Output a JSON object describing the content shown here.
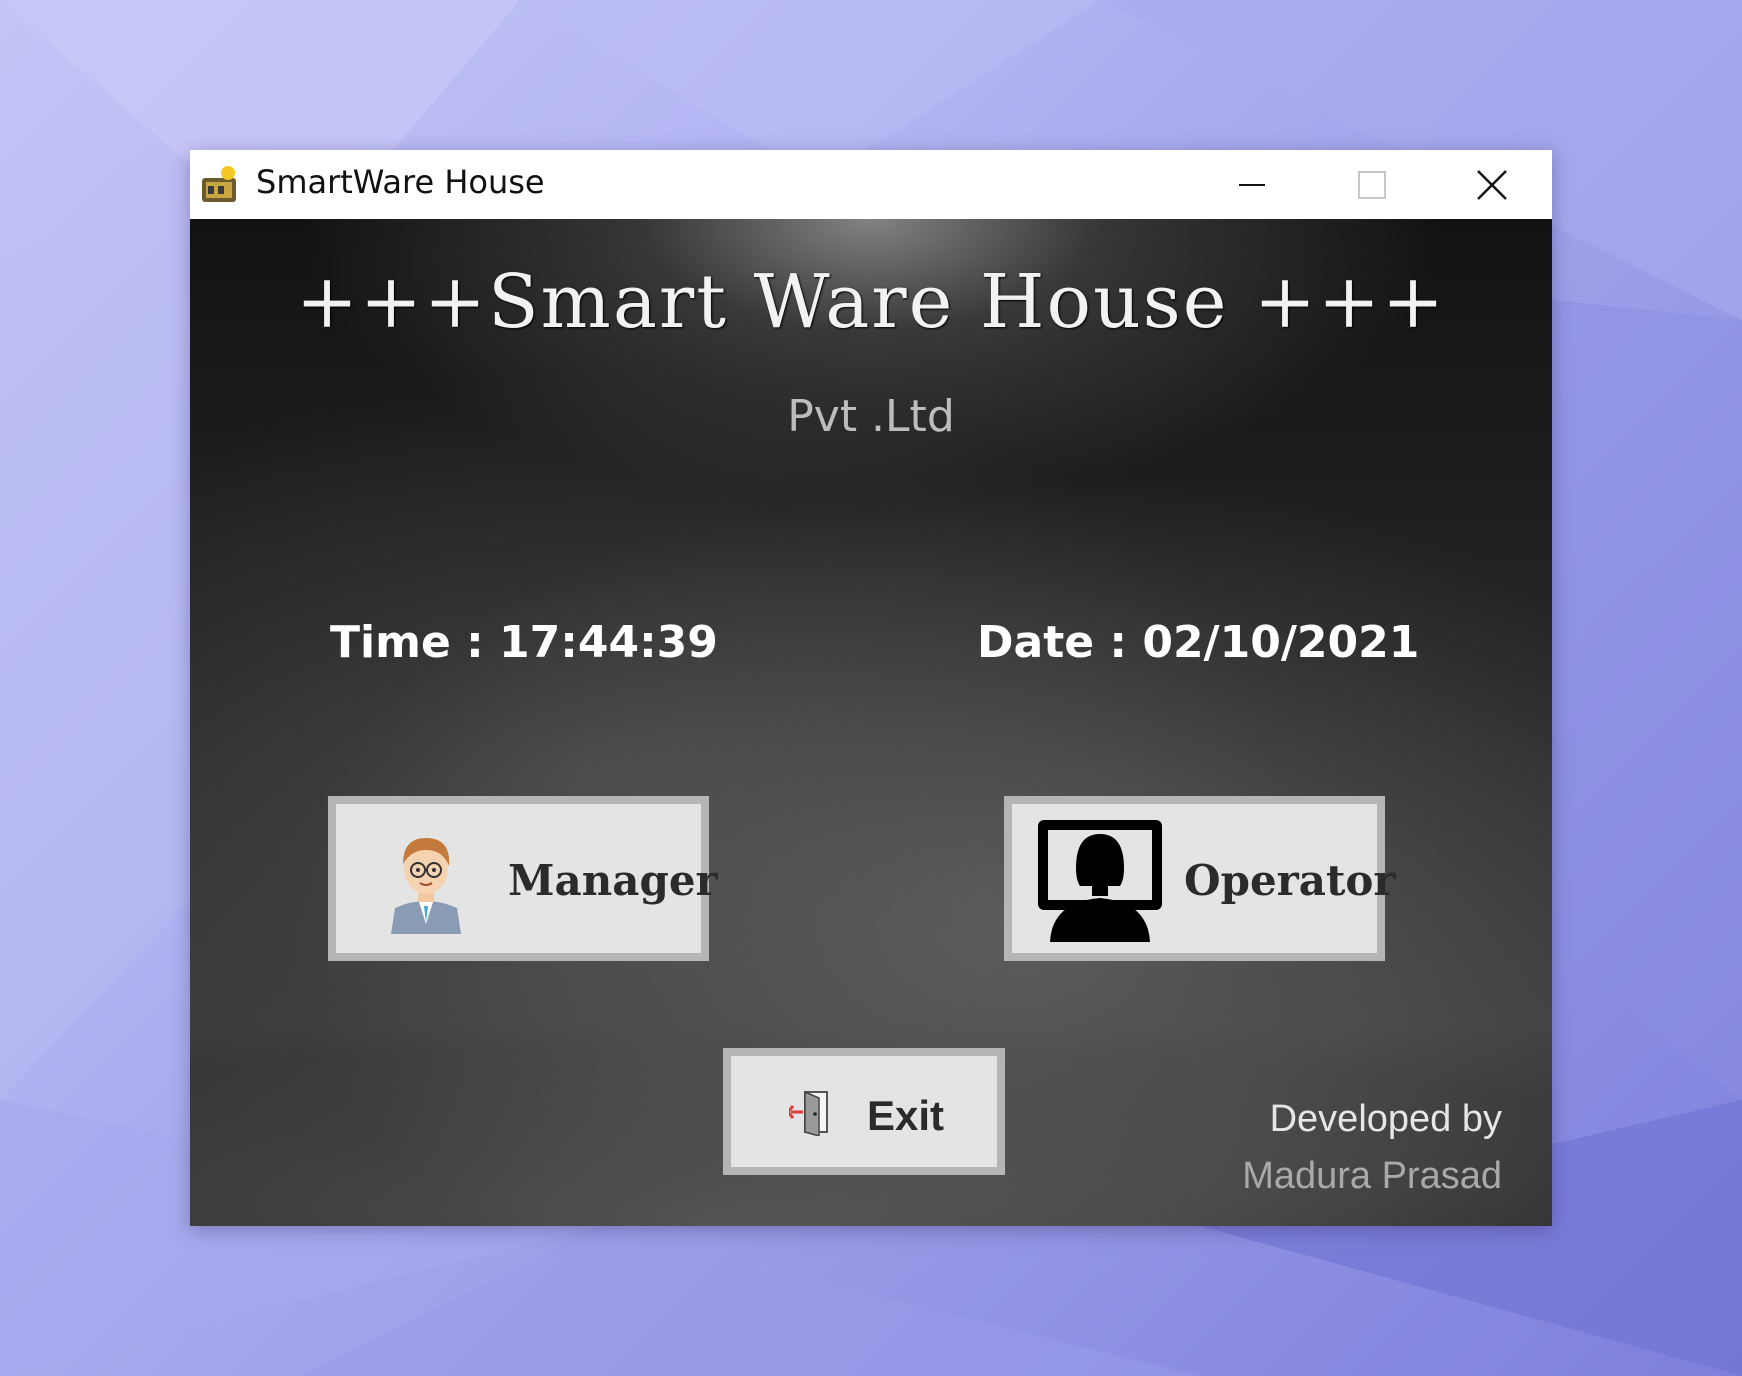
{
  "window": {
    "title": "SmartWare House",
    "controls": {
      "minimize": "minimize-icon",
      "maximize": "maximize-icon",
      "close": "close-icon"
    }
  },
  "header": {
    "title": "+++Smart Ware House +++",
    "subtitle": "Pvt .Ltd"
  },
  "clock": {
    "time": "Time : 17:44:39",
    "date": "Date : 02/10/2021"
  },
  "buttons": {
    "manager": {
      "label": "Manager",
      "icon": "manager-avatar-icon"
    },
    "operator": {
      "label": "Operator",
      "icon": "operator-monitor-icon"
    },
    "exit": {
      "label": "Exit",
      "icon": "exit-door-icon"
    }
  },
  "footer": {
    "credit_line1": "Developed by",
    "credit_line2": "Madura Prasad"
  },
  "colors": {
    "desktop_background": "#b3b5f3",
    "content_background": "#262626",
    "button_face": "#e4e4e4",
    "button_border": "#b5b5b5"
  }
}
